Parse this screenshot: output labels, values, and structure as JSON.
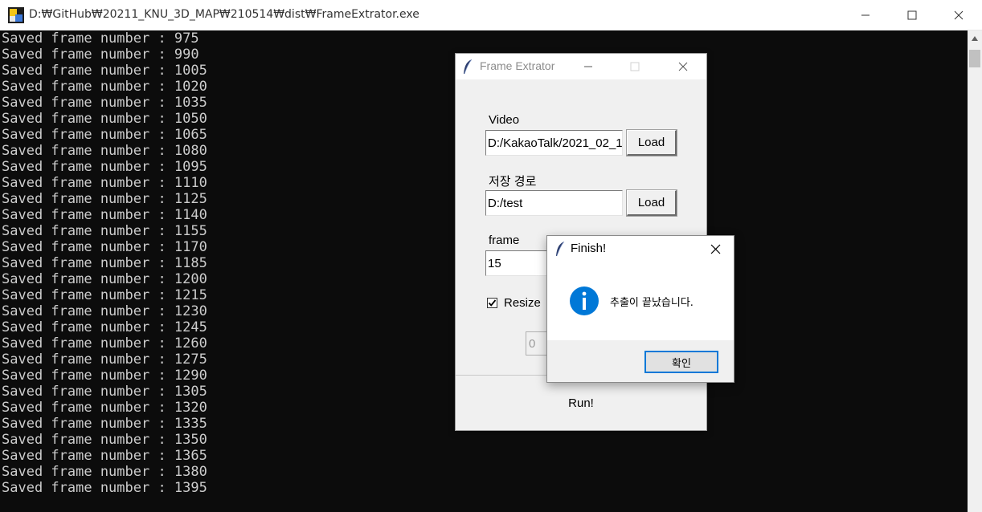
{
  "console": {
    "title": "D:₩GitHub₩20211_KNU_3D_MAP₩210514₩dist₩FrameExtrator.exe",
    "lines": [
      "Saved frame number : 975",
      "Saved frame number : 990",
      "Saved frame number : 1005",
      "Saved frame number : 1020",
      "Saved frame number : 1035",
      "Saved frame number : 1050",
      "Saved frame number : 1065",
      "Saved frame number : 1080",
      "Saved frame number : 1095",
      "Saved frame number : 1110",
      "Saved frame number : 1125",
      "Saved frame number : 1140",
      "Saved frame number : 1155",
      "Saved frame number : 1170",
      "Saved frame number : 1185",
      "Saved frame number : 1200",
      "Saved frame number : 1215",
      "Saved frame number : 1230",
      "Saved frame number : 1245",
      "Saved frame number : 1260",
      "Saved frame number : 1275",
      "Saved frame number : 1290",
      "Saved frame number : 1305",
      "Saved frame number : 1320",
      "Saved frame number : 1335",
      "Saved frame number : 1350",
      "Saved frame number : 1365",
      "Saved frame number : 1380",
      "Saved frame number : 1395"
    ]
  },
  "app": {
    "title": "Frame Extrator",
    "video_label": "Video",
    "video_value": "D:/KakaoTalk/2021_02_1",
    "video_load": "Load",
    "save_label": "저장 경로",
    "save_value": "D:/test",
    "save_load": "Load",
    "frame_label": "frame",
    "frame_value": "15",
    "resize_label": "Resize",
    "resize_checked": true,
    "resize_value": "0",
    "run_label": "Run!"
  },
  "dialog": {
    "title": "Finish!",
    "message": "추출이 끝났습니다.",
    "ok_label": "확인",
    "icon": "info-icon",
    "accent": "#0078d7"
  }
}
